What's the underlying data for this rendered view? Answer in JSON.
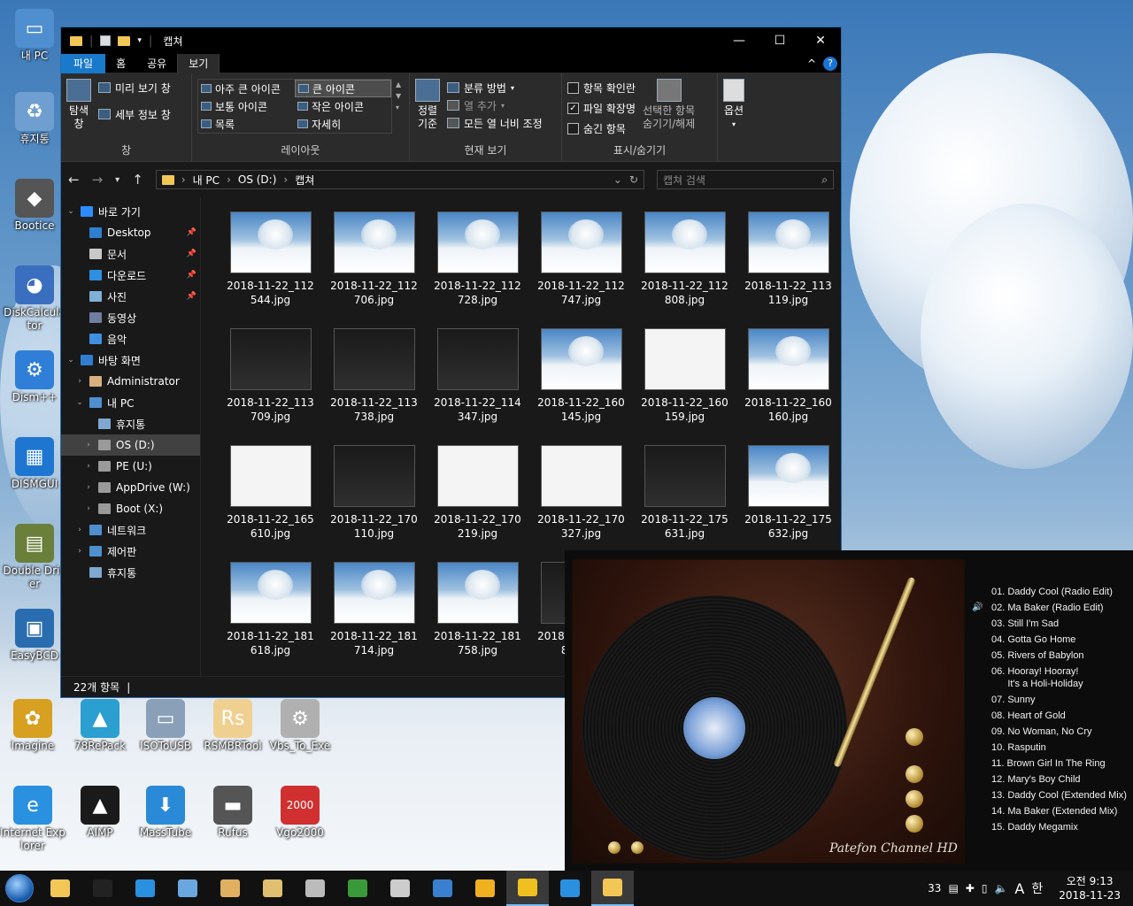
{
  "desktop": {
    "icons": [
      {
        "label": "내 PC",
        "color": "#4f8fcf",
        "glyph": "▭"
      },
      {
        "label": "휴지통",
        "color": "#6f9fd0",
        "glyph": "♻"
      },
      {
        "label": "Bootice",
        "color": "#555555",
        "glyph": "◆"
      },
      {
        "label": "DiskCalculator",
        "color": "#3a6fbf",
        "glyph": "◕"
      },
      {
        "label": "Dism++",
        "color": "#2f7fd8",
        "glyph": "⚙"
      },
      {
        "label": "DISMGUI",
        "color": "#1f76d0",
        "glyph": "▦"
      },
      {
        "label": "Double Driver",
        "color": "#6a7f3a",
        "glyph": "▤"
      },
      {
        "label": "EasyBCD",
        "color": "#2a6cb0",
        "glyph": "▣"
      }
    ],
    "bottom_icons": [
      {
        "label": "Imagine",
        "color": "#d8a020",
        "glyph": "✿"
      },
      {
        "label": "78RePack",
        "color": "#2a9fd0",
        "glyph": "▲"
      },
      {
        "label": "ISOToUSB",
        "color": "#8aa0b8",
        "glyph": "▭"
      },
      {
        "label": "RSMBRTool",
        "color": "#f0d090",
        "glyph": "Rs"
      },
      {
        "label": "Vbs_To_Exe",
        "color": "#b0b0b0",
        "glyph": "⚙"
      },
      {
        "label": "Internet Explorer",
        "color": "#2a90e0",
        "glyph": "e"
      },
      {
        "label": "AIMP",
        "color": "#1a1a1a",
        "glyph": "▲"
      },
      {
        "label": "MassTube",
        "color": "#2a8ad8",
        "glyph": "⬇"
      },
      {
        "label": "Rufus",
        "color": "#555555",
        "glyph": "▬"
      },
      {
        "label": "Vgo2000",
        "color": "#d03030",
        "glyph": "2000"
      }
    ]
  },
  "window": {
    "title": "캡쳐",
    "controls": {
      "minimize": "—",
      "maximize": "☐",
      "close": "✕"
    },
    "menu_tabs": {
      "file": "파일",
      "home": "홈",
      "share": "공유",
      "view": "보기"
    },
    "help": "?",
    "collapse": "^",
    "ribbon": {
      "pane": {
        "nav_pane": "탐색\n창",
        "preview": "미리 보기 창",
        "details": "세부 정보 창",
        "group": "창"
      },
      "layout": {
        "items": [
          "아주 큰 아이콘",
          "큰 아이콘",
          "보통 아이콘",
          "작은 아이콘",
          "목록",
          "자세히"
        ],
        "group": "레이아웃"
      },
      "current_view": {
        "sort": "정렬\n기준",
        "group_by": "분류 방법",
        "add_column": "열 추가",
        "fit_columns": "모든 열 너비 조정",
        "group": "현재 보기"
      },
      "show_hide": {
        "item_checkbox": "항목 확인란",
        "extensions": "파일 확장명",
        "hidden": "숨긴 항목",
        "hide_selected": "선택한 항목\n숨기기/해제",
        "group": "표시/숨기기"
      },
      "options": {
        "label": "옵션"
      }
    },
    "address": {
      "segments": [
        "내 PC",
        "OS (D:)",
        "캡쳐"
      ],
      "search_placeholder": "캡쳐 검색"
    },
    "nav_tree": [
      {
        "label": "바로 가기",
        "indent": 0,
        "chev": "v",
        "color": "#2e8bff"
      },
      {
        "label": "Desktop",
        "indent": 1,
        "chev": "",
        "color": "#2f7fd0",
        "pin": true
      },
      {
        "label": "문서",
        "indent": 1,
        "chev": "",
        "color": "#c8c8c8",
        "pin": true
      },
      {
        "label": "다운로드",
        "indent": 1,
        "chev": "",
        "color": "#2f8fe0",
        "pin": true
      },
      {
        "label": "사진",
        "indent": 1,
        "chev": "",
        "color": "#7fb0d8",
        "pin": true
      },
      {
        "label": "동영상",
        "indent": 1,
        "chev": "",
        "color": "#6f7f9f"
      },
      {
        "label": "음악",
        "indent": 1,
        "chev": "",
        "color": "#3f8fe0"
      },
      {
        "label": "바탕 화면",
        "indent": 0,
        "chev": "v",
        "color": "#2f7fd0"
      },
      {
        "label": "Administrator",
        "indent": 1,
        "chev": ">",
        "color": "#d8b080"
      },
      {
        "label": "내 PC",
        "indent": 1,
        "chev": "v",
        "color": "#4f8fcf"
      },
      {
        "label": "휴지통",
        "indent": 2,
        "chev": "",
        "color": "#7fa7cf"
      },
      {
        "label": "OS (D:)",
        "indent": 2,
        "chev": ">",
        "color": "#9a9a9a",
        "selected": true
      },
      {
        "label": "PE (U:)",
        "indent": 2,
        "chev": ">",
        "color": "#9a9a9a"
      },
      {
        "label": "AppDrive (W:)",
        "indent": 2,
        "chev": ">",
        "color": "#9a9a9a"
      },
      {
        "label": "Boot (X:)",
        "indent": 2,
        "chev": ">",
        "color": "#9a9a9a"
      },
      {
        "label": "네트워크",
        "indent": 1,
        "chev": ">",
        "color": "#4f8fcf"
      },
      {
        "label": "제어판",
        "indent": 1,
        "chev": ">",
        "color": "#4f8fcf"
      },
      {
        "label": "휴지통",
        "indent": 1,
        "chev": "",
        "color": "#7fa7cf"
      }
    ],
    "files": [
      {
        "name": "2018-11-22_112544.jpg",
        "kind": "w"
      },
      {
        "name": "2018-11-22_112706.jpg",
        "kind": "w"
      },
      {
        "name": "2018-11-22_112728.jpg",
        "kind": "w"
      },
      {
        "name": "2018-11-22_112747.jpg",
        "kind": "w"
      },
      {
        "name": "2018-11-22_112808.jpg",
        "kind": "w"
      },
      {
        "name": "2018-11-22_113119.jpg",
        "kind": "w"
      },
      {
        "name": "2018-11-22_113709.jpg",
        "kind": "d"
      },
      {
        "name": "2018-11-22_113738.jpg",
        "kind": "d"
      },
      {
        "name": "2018-11-22_114347.jpg",
        "kind": "d"
      },
      {
        "name": "2018-11-22_160145.jpg",
        "kind": "w"
      },
      {
        "name": "2018-11-22_160159.jpg",
        "kind": "p"
      },
      {
        "name": "2018-11-22_160160.jpg",
        "kind": "w"
      },
      {
        "name": "2018-11-22_165610.jpg",
        "kind": "p"
      },
      {
        "name": "2018-11-22_170110.jpg",
        "kind": "d"
      },
      {
        "name": "2018-11-22_170219.jpg",
        "kind": "p"
      },
      {
        "name": "2018-11-22_170327.jpg",
        "kind": "p"
      },
      {
        "name": "2018-11-22_175631.jpg",
        "kind": "d"
      },
      {
        "name": "2018-11-22_175632.jpg",
        "kind": "w"
      },
      {
        "name": "2018-11-22_181618.jpg",
        "kind": "w"
      },
      {
        "name": "2018-11-22_181714.jpg",
        "kind": "w"
      },
      {
        "name": "2018-11-22_181758.jpg",
        "kind": "w"
      },
      {
        "name": "2018-11-22_181803.jpg",
        "kind": "d"
      }
    ],
    "status": {
      "count": "22개 항목",
      "cursor": "|"
    }
  },
  "player": {
    "brand": "Patefon Channel HD",
    "playlist": [
      "01. Daddy Cool (Radio Edit)",
      "02. Ma Baker (Radio Edit)",
      "03. Still I'm Sad",
      "04. Gotta Go Home",
      "05. Rivers of Babylon",
      "06. Hooray! Hooray!\n      It's a Holi-Holiday",
      "07. Sunny",
      "08. Heart of Gold",
      "09. No Woman, No Cry",
      "10. Rasputin",
      "11. Brown Girl In The Ring",
      "12. Mary's Boy Child",
      "13. Daddy Cool (Extended Mix)",
      "14. Ma Baker (Extended Mix)",
      "15. Daddy Megamix"
    ],
    "now_playing_index": 1,
    "speaker": "🔊"
  },
  "taskbar": {
    "buttons": [
      {
        "name": "explorer",
        "color": "#f2c755"
      },
      {
        "name": "cmd",
        "color": "#222222"
      },
      {
        "name": "ie",
        "color": "#2a90e0"
      },
      {
        "name": "notepad",
        "color": "#6aa7e0"
      },
      {
        "name": "paint",
        "color": "#e0b060"
      },
      {
        "name": "rsmbr",
        "color": "#e0c070"
      },
      {
        "name": "bootice",
        "color": "#bbbbbb"
      },
      {
        "name": "dism",
        "color": "#3a9a3a"
      },
      {
        "name": "cloud",
        "color": "#cccccc"
      },
      {
        "name": "screen",
        "color": "#3a7fd0"
      },
      {
        "name": "aimp",
        "color": "#f0b020"
      },
      {
        "name": "player",
        "color": "#f0c020",
        "active": true
      },
      {
        "name": "ie2",
        "color": "#2a90e0"
      },
      {
        "name": "explorer2",
        "color": "#f2c755",
        "active": true
      }
    ],
    "tray": {
      "ime_num": "33",
      "lang": "A",
      "ime": "한",
      "time": "오전 9:13",
      "date": "2018-11-23"
    }
  }
}
